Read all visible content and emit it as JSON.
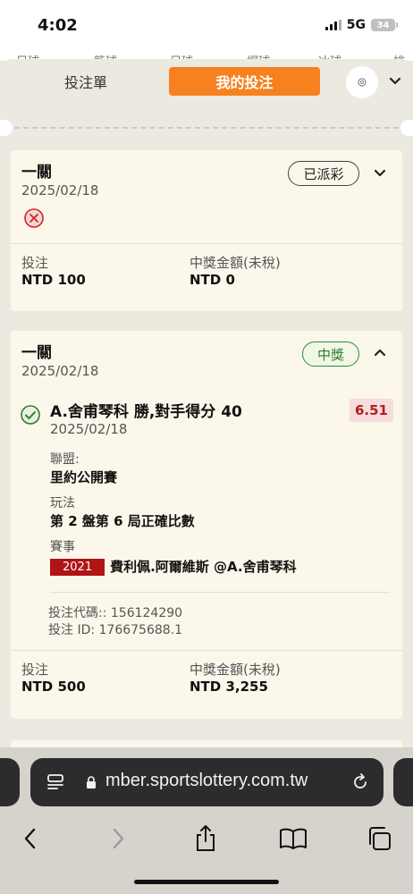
{
  "status_bar": {
    "time": "4:02",
    "network": "5G",
    "battery": "34"
  },
  "sport_tabs": [
    "足球",
    "籃球",
    "足球",
    "網球",
    "冰球",
    "排球"
  ],
  "sheet": {
    "tab_betslip": "投注單",
    "tab_mybets": "我的投注"
  },
  "bets": [
    {
      "title": "一關",
      "date": "2025/02/18",
      "status": "已派彩",
      "result_icon": "cross-circle-icon",
      "stake_label": "投注",
      "stake_value": "NTD 100",
      "payout_label": "中獎金額(未稅)",
      "payout_value": "NTD 0"
    },
    {
      "title": "一關",
      "date": "2025/02/18",
      "status": "中獎",
      "selection": {
        "name": "A.舍甫琴科 勝,對手得分 40",
        "date": "2025/02/18",
        "odds": "6.51",
        "league_label": "聯盟:",
        "league_value": "里約公開賽",
        "play_label": "玩法",
        "play_value": "第 2 盤第 6 局正確比數",
        "event_label": "賽事",
        "event_year": "2021",
        "event_value": "費利佩.阿爾維斯 @A.舍甫琴科"
      },
      "bet_code": "投注代碼:: 156124290",
      "bet_id": "投注 ID: 176675688.1",
      "stake_label": "投注",
      "stake_value": "NTD 500",
      "payout_label": "中獎金額(未稅)",
      "payout_value": "NTD 3,255"
    }
  ],
  "browser": {
    "url": "mber.sportslottery.com.tw"
  },
  "colors": {
    "accent": "#f7801f",
    "win": "#2e8b3a",
    "loss": "#c62828",
    "odds_bg": "#f6dcdc"
  }
}
